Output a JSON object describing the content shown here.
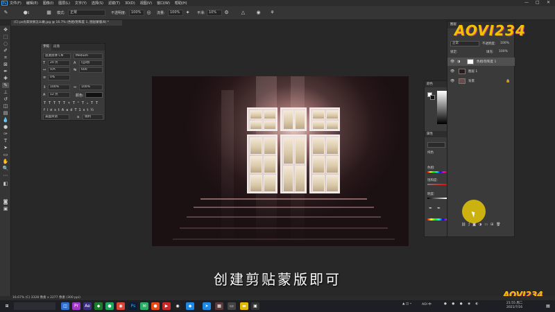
{
  "menubar": {
    "logo": "Ps",
    "items": [
      "文件(F)",
      "编辑(E)",
      "图像(I)",
      "图层(L)",
      "文字(Y)",
      "选择(S)",
      "滤镜(T)",
      "3D(D)",
      "视图(V)",
      "窗口(W)",
      "帮助(H)"
    ],
    "minimize": "—",
    "restore": "□",
    "close": "✕"
  },
  "options": {
    "mode_label": "模式:",
    "mode_value": "正常",
    "opacity_label": "不透明度:",
    "opacity_value": "100%",
    "flow_label": "流量:",
    "flow_value": "100%",
    "smooth_label": "平滑:",
    "smooth_value": "10%",
    "brush_size": "5"
  },
  "document": {
    "tab_label": "(C) ps光束效果怎么做.jpg @ 16.7% (色相/饱和度 1, 图层蒙版/8) *"
  },
  "character_panel": {
    "tab_character": "字符",
    "tab_paragraph": "段落",
    "font_family": "思源黑体 CN",
    "font_style": "Medium",
    "font_size": "20 点",
    "leading": "(自动)",
    "kerning": "V/A",
    "tracking": "600",
    "scale_h": "0%",
    "scale_v": "100%",
    "scale_w": "100%",
    "baseline": "12 点",
    "color_label": "颜色:",
    "language": "美国英语",
    "antialias": "锐利",
    "style_buttons": [
      "T",
      "T",
      "TT",
      "Tт",
      "T¹",
      "T₁",
      "T",
      "T"
    ],
    "feature_buttons": [
      "fi",
      "ơ",
      "st",
      "A",
      "ad",
      "T",
      "1st",
      "½"
    ]
  },
  "color_panel": {
    "tab": "颜色",
    "props_tab": "属性",
    "label_1": "纯色",
    "label_2": "色相:",
    "label_3": "饱和度:",
    "label_4": "明度:"
  },
  "layers_panel": {
    "tab": "图层",
    "blend_mode": "正常",
    "opacity_label": "不透明度:",
    "opacity_value": "100%",
    "fill_label": "填充:",
    "fill_value": "100%",
    "lock_label": "锁定:",
    "layers": [
      {
        "name": "色相/饱和度 1"
      },
      {
        "name": "图层 1"
      },
      {
        "name": "背景"
      }
    ]
  },
  "caption": "创建剪贴蒙版即可",
  "statusbar": {
    "text": "16.67%   (C) 3328 像素 x 2277 像素 (300 ppi)"
  },
  "taskbar": {
    "clock_time": "21:55 周二",
    "clock_date": "2021/7/16",
    "tray_text": "AOI 中"
  },
  "watermark": "AOVI234",
  "colors": {
    "accent_blue": "#31a8ff",
    "panel_bg": "#3a3a3a",
    "workspace_bg": "#282828",
    "highlight_yellow": "#e6c80a"
  }
}
